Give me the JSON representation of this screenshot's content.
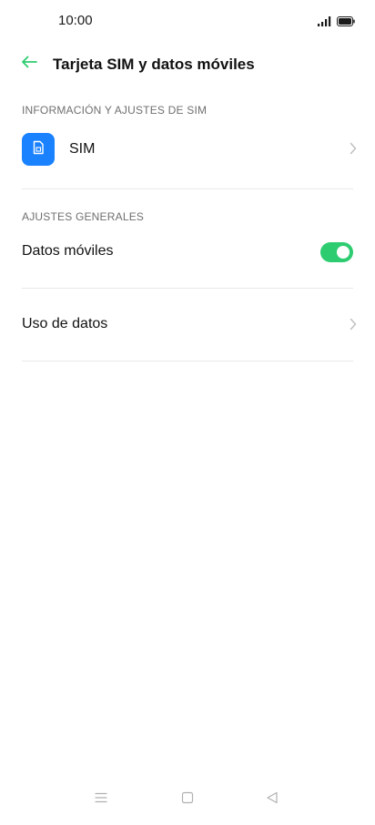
{
  "status_bar": {
    "time": "10:00"
  },
  "header": {
    "title": "Tarjeta SIM y datos móviles",
    "back_icon": "arrow-left-icon",
    "accent_color": "#2ecc71"
  },
  "sections": {
    "sim_info": {
      "title": "INFORMACIÓN Y AJUSTES DE SIM",
      "items": [
        {
          "label": "SIM",
          "icon": "sim-card-icon",
          "icon_bg": "#1a82ff"
        }
      ]
    },
    "general": {
      "title": "AJUSTES GENERALES",
      "mobile_data": {
        "label": "Datos móviles",
        "toggle_on": true
      },
      "data_usage": {
        "label": "Uso de datos"
      }
    }
  },
  "nav_bar": {
    "menu_icon": "menu-icon",
    "home_icon": "home-square-icon",
    "back_icon": "back-triangle-icon"
  }
}
